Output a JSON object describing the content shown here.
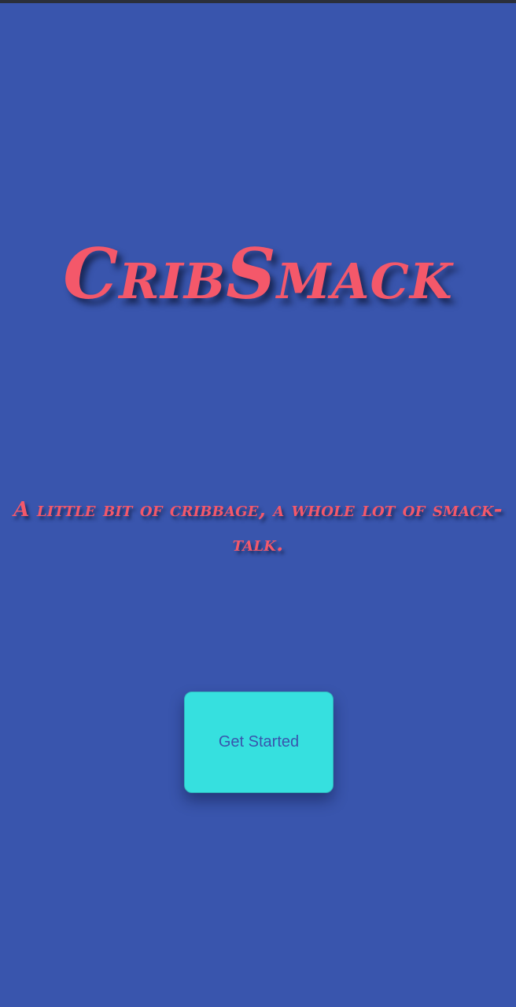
{
  "app": {
    "title": "CribSmack",
    "tagline": "A little bit of cribbage, a whole lot of smack-talk."
  },
  "actions": {
    "get_started_label": "Get Started"
  },
  "colors": {
    "background": "#3955ad",
    "title_text": "#f4586a",
    "button_background": "#36e0df",
    "button_text": "#3955ad"
  }
}
